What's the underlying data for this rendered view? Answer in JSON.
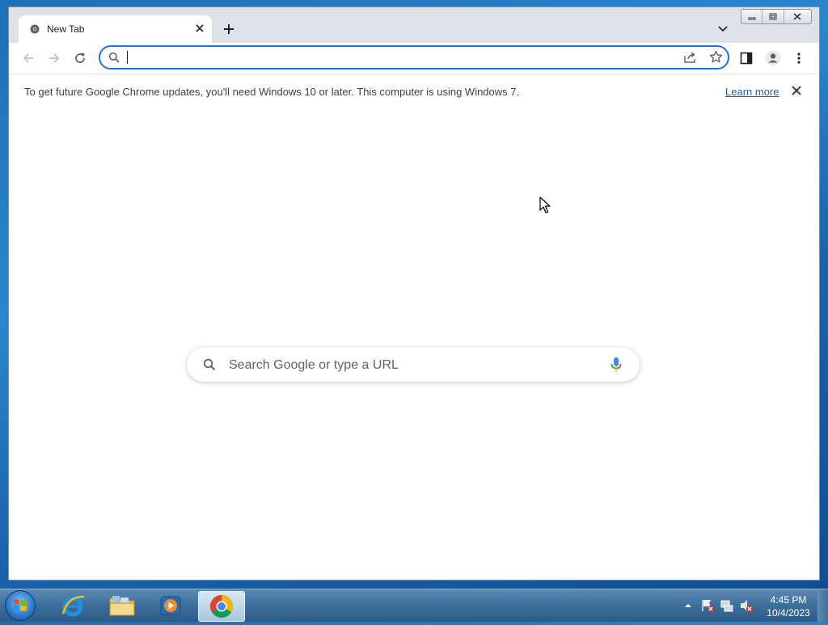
{
  "browser": {
    "tab": {
      "title": "New Tab"
    },
    "address_bar": {
      "value": "",
      "placeholder": ""
    },
    "infobar": {
      "message": "To get future Google Chrome updates, you'll need Windows 10 or later. This computer is using Windows 7.",
      "link": "Learn more"
    },
    "ntp": {
      "search_placeholder": "Search Google or type a URL"
    }
  },
  "taskbar": {
    "clock": {
      "time": "4:45 PM",
      "date": "10/4/2023"
    },
    "items": [
      "start-orb",
      "internet-explorer-icon",
      "file-explorer-icon",
      "media-player-icon",
      "chrome-icon"
    ]
  },
  "colors": {
    "accent": "#1a73e8",
    "tabstrip": "#dee1e6",
    "link": "#1a5fb4"
  }
}
